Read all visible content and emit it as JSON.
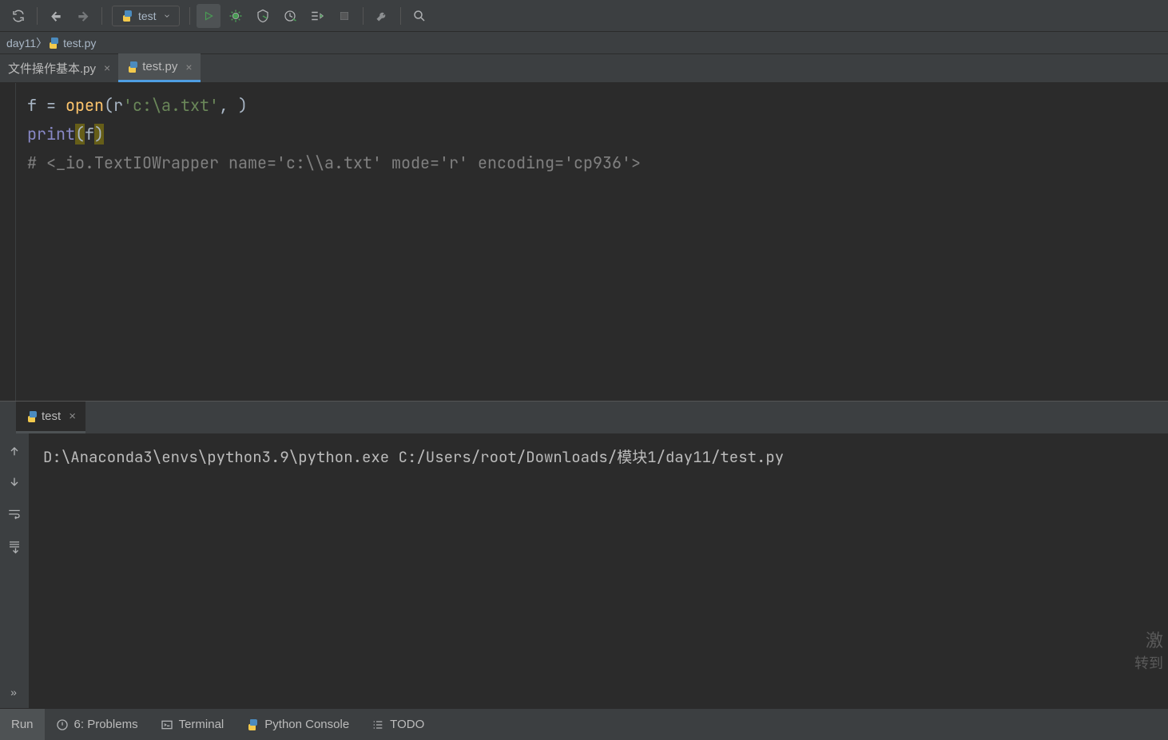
{
  "toolbar": {
    "run_config_label": "test"
  },
  "breadcrumb": {
    "item0": "day11",
    "item1": "test.py"
  },
  "tabs": {
    "items": [
      {
        "label": "文件操作基本.py"
      },
      {
        "label": "test.py"
      }
    ]
  },
  "code": {
    "l1_a": "f ",
    "l1_eq": "= ",
    "l1_fn": "open",
    "l1_par_o": "(",
    "l1_r": "r",
    "l1_str": "'c:\\a.txt'",
    "l1_rest": ", ",
    "l1_par_c": ")",
    "l2_fn": "print",
    "l2_par_o": "(",
    "l2_arg": "f",
    "l2_par_c": ")",
    "l3": "# <_io.TextIOWrapper name='c:\\\\a.txt' mode='r' encoding='cp936'>"
  },
  "run": {
    "tab_label": "test",
    "output_line": "D:\\Anaconda3\\envs\\python3.9\\python.exe C:/Users/root/Downloads/模块1/day11/test.py"
  },
  "bottom": {
    "run": "Run",
    "problems": "6: Problems",
    "terminal": "Terminal",
    "pyconsole": "Python Console",
    "todo": "TODO"
  },
  "watermark": {
    "line1": "激",
    "line2": "转到"
  }
}
